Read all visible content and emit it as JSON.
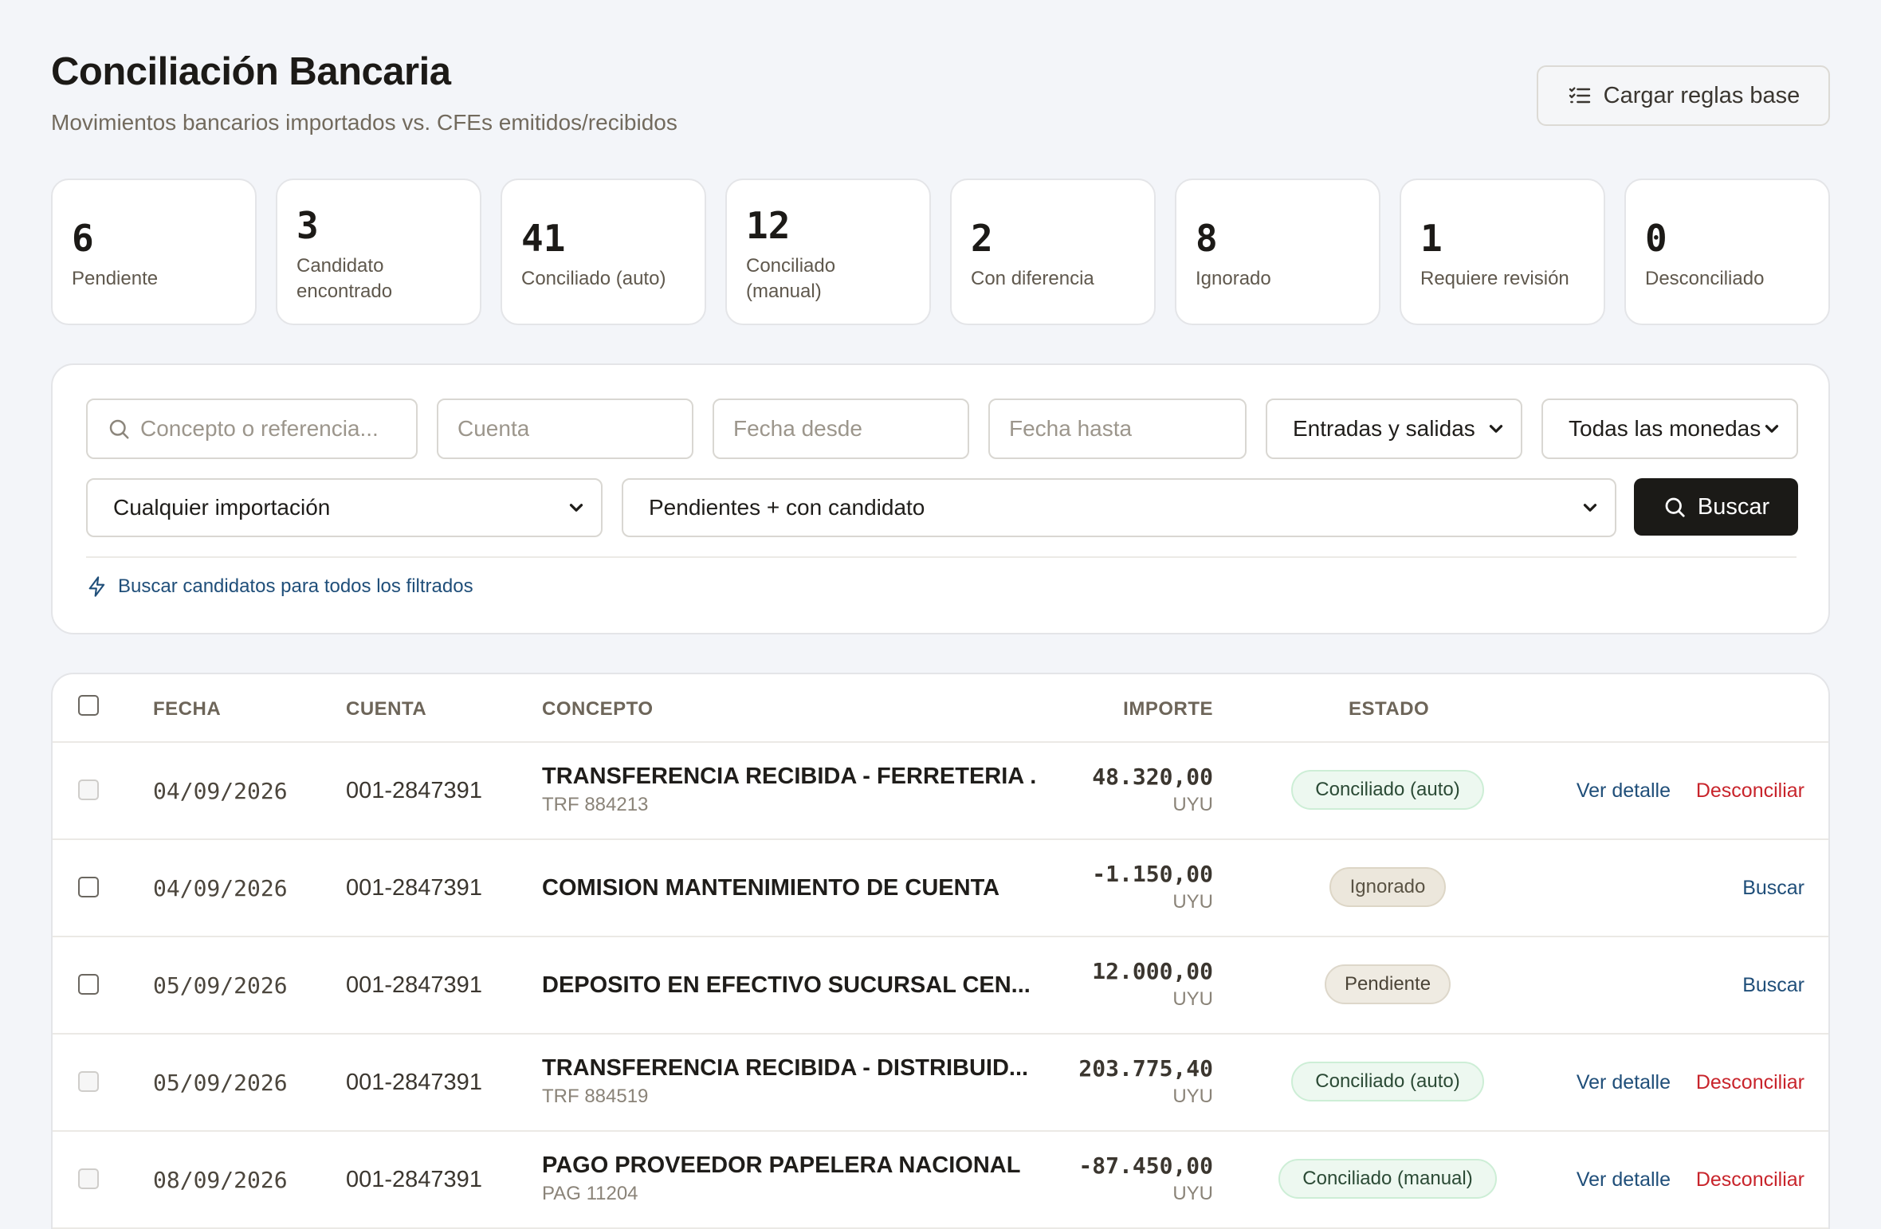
{
  "header": {
    "title": "Conciliación Bancaria",
    "subtitle": "Movimientos bancarios importados vs. CFEs emitidos/recibidos",
    "rules_button": "Cargar reglas base"
  },
  "stats": [
    {
      "value": "6",
      "label": "Pendiente"
    },
    {
      "value": "3",
      "label": "Candidato encontrado"
    },
    {
      "value": "41",
      "label": "Conciliado (auto)"
    },
    {
      "value": "12",
      "label": "Conciliado (manual)"
    },
    {
      "value": "2",
      "label": "Con diferencia"
    },
    {
      "value": "8",
      "label": "Ignorado"
    },
    {
      "value": "1",
      "label": "Requiere revisión"
    },
    {
      "value": "0",
      "label": "Desconciliado"
    }
  ],
  "filters": {
    "search_placeholder": "Concepto o referencia...",
    "account_placeholder": "Cuenta",
    "date_from_placeholder": "Fecha desde",
    "date_to_placeholder": "Fecha hasta",
    "direction_selected": "Entradas y salidas",
    "currency_selected": "Todas las monedas",
    "import_selected": "Cualquier importación",
    "status_selected": "Pendientes + con candidato",
    "search_button": "Buscar",
    "bulk_link": "Buscar candidatos para todos los filtrados"
  },
  "table": {
    "columns": {
      "date": "FECHA",
      "account": "CUENTA",
      "concept": "CONCEPTO",
      "amount": "IMPORTE",
      "status": "ESTADO"
    },
    "rows": [
      {
        "date": "04/09/2026",
        "account": "001-2847391",
        "concept": "TRANSFERENCIA RECIBIDA - FERRETERIA ...",
        "ref": "TRF 884213",
        "amount": "48.320,00",
        "currency": "UYU",
        "status": "Conciliado (auto)",
        "action1": "Ver detalle",
        "action2": "Desconciliar"
      },
      {
        "date": "04/09/2026",
        "account": "001-2847391",
        "concept": "COMISION MANTENIMIENTO DE CUENTA",
        "ref": "",
        "amount": "-1.150,00",
        "currency": "UYU",
        "status": "Ignorado",
        "action1": "",
        "action2": "Buscar"
      },
      {
        "date": "05/09/2026",
        "account": "001-2847391",
        "concept": "DEPOSITO EN EFECTIVO SUCURSAL CEN...",
        "ref": "",
        "amount": "12.000,00",
        "currency": "UYU",
        "status": "Pendiente",
        "action1": "",
        "action2": "Buscar"
      },
      {
        "date": "05/09/2026",
        "account": "001-2847391",
        "concept": "TRANSFERENCIA RECIBIDA - DISTRIBUID...",
        "ref": "TRF 884519",
        "amount": "203.775,40",
        "currency": "UYU",
        "status": "Conciliado (auto)",
        "action1": "Ver detalle",
        "action2": "Desconciliar"
      },
      {
        "date": "08/09/2026",
        "account": "001-2847391",
        "concept": "PAGO PROVEEDOR PAPELERA NACIONAL",
        "ref": "PAG 11204",
        "amount": "-87.450,00",
        "currency": "UYU",
        "status": "Conciliado (manual)",
        "action1": "Ver detalle",
        "action2": "Desconciliar"
      }
    ]
  },
  "colors": {
    "accent_dark": "#1b1a17",
    "link_blue": "#1f4e79",
    "danger_red": "#c8242b",
    "success_bg": "#edf8f0"
  }
}
